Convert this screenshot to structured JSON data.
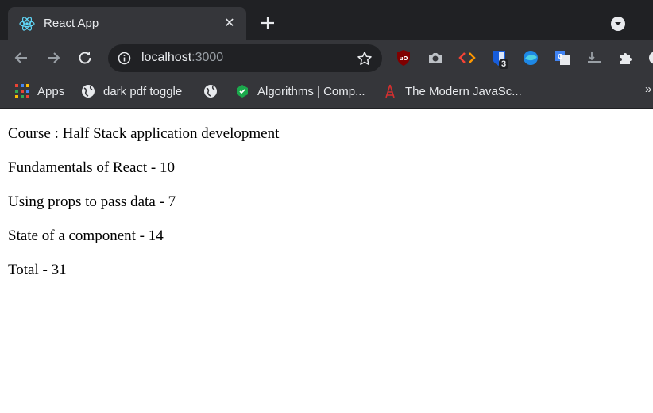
{
  "browser": {
    "tab": {
      "title": "React App",
      "close": "✕"
    },
    "address_bar": {
      "host": "localhost",
      "port": ":3000"
    },
    "extensions": [
      {
        "name": "ublock-icon",
        "badge": ""
      },
      {
        "name": "camera-icon",
        "badge": ""
      },
      {
        "name": "code-icon",
        "badge": ""
      },
      {
        "name": "bitwarden-icon",
        "badge": "3"
      },
      {
        "name": "blue-ext-icon",
        "badge": ""
      },
      {
        "name": "translate-icon",
        "badge": ""
      },
      {
        "name": "tray-icon",
        "badge": ""
      },
      {
        "name": "puzzle-icon",
        "badge": ""
      }
    ],
    "bookmarks": {
      "apps": "Apps",
      "items": [
        {
          "label": "dark pdf toggle"
        },
        {
          "label": ""
        },
        {
          "label": "Algorithms | Comp..."
        },
        {
          "label": "The Modern JavaSc..."
        }
      ],
      "overflow": "»"
    }
  },
  "page": {
    "course": "Course : Half Stack application development",
    "parts": [
      "Fundamentals of React - 10",
      "Using props to pass data - 7",
      "State of a component - 14"
    ],
    "total": "Total - 31"
  },
  "colors": {
    "chrome_dark": "#202124",
    "chrome_mid": "#35363a",
    "text_light": "#e8eaed",
    "react_cyan": "#61dafb"
  }
}
